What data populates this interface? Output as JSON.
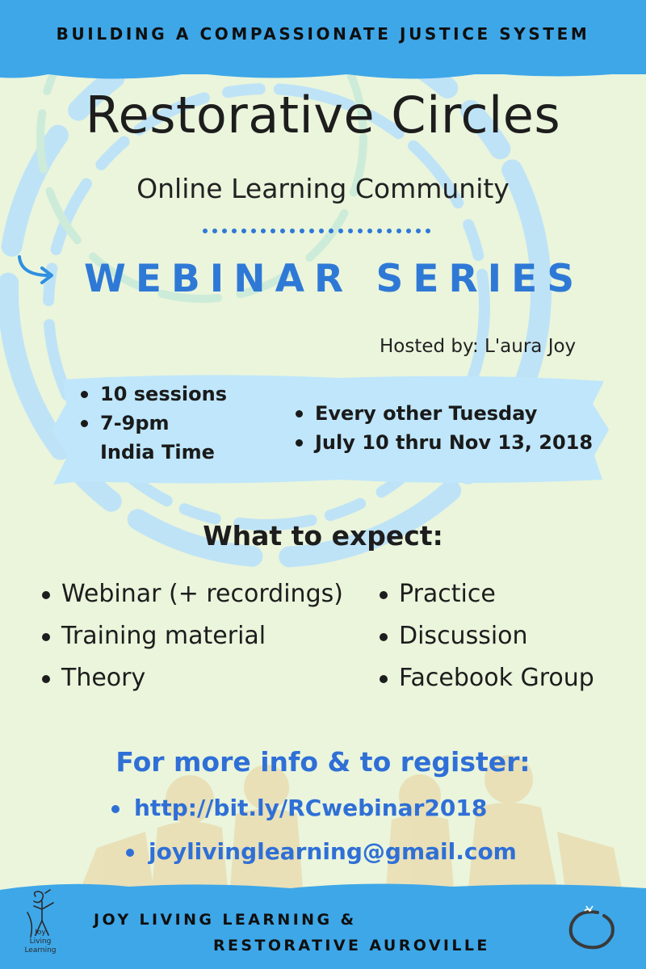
{
  "header": {
    "tagline": "BUILDING A COMPASSIONATE JUSTICE SYSTEM"
  },
  "title": "Restorative Circles",
  "subtitle": "Online Learning Community",
  "series": "WEBINAR SERIES",
  "host": "Hosted by:  L'aura Joy",
  "schedule": {
    "left": [
      "10 sessions",
      "7-9pm"
    ],
    "left_cont": "India Time",
    "right": [
      "Every other Tuesday",
      "July 10 thru Nov 13, 2018"
    ]
  },
  "expect": {
    "title": "What to expect:",
    "left": [
      "Webinar (+ recordings)",
      "Training material",
      "Theory"
    ],
    "right": [
      "Practice",
      "Discussion",
      "Facebook Group"
    ]
  },
  "register": {
    "title": "For more info & to register:",
    "url": "http://bit.ly/RCwebinar2018",
    "email": "joylivinglearning@gmail.com"
  },
  "footer": {
    "line1": "JOY LIVING LEARNING &",
    "line2": "RESTORATIVE AUROVILLE"
  },
  "logo_left": {
    "words": [
      "Joy",
      "Living",
      "Learning"
    ]
  },
  "colors": {
    "background": "#eaf5dc",
    "banner_blue": "#3ea7e8",
    "highlight_blue": "#bfe6fb",
    "accent_blue": "#2f79d6",
    "text_dark": "#1d1d1d"
  },
  "icons": {
    "arrow": "curved-arrow-right-icon",
    "logo_left": "joy-figure-logo",
    "logo_right": "enso-circle-logo"
  }
}
